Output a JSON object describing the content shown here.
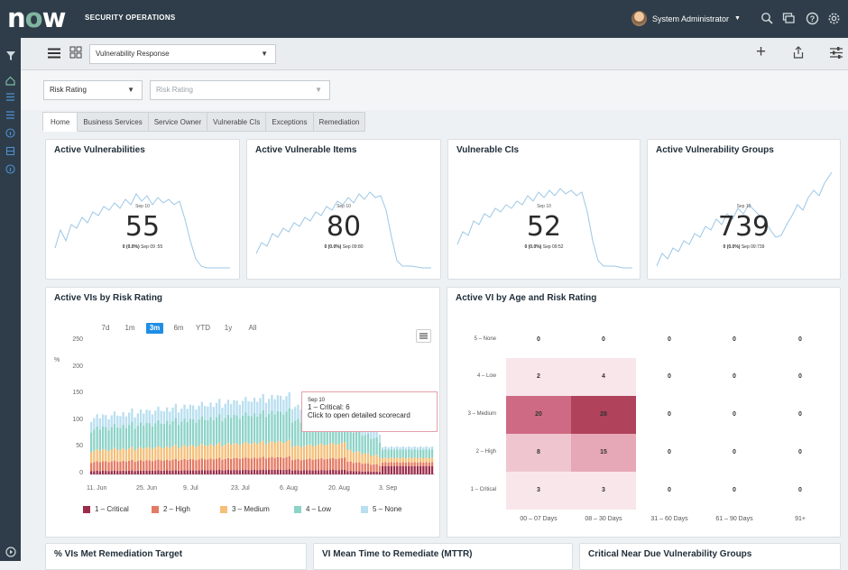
{
  "header": {
    "logo": "now",
    "product": "SECURITY OPERATIONS",
    "user": "System Administrator"
  },
  "toolbar": {
    "workspace": "Vulnerability Response"
  },
  "filters": {
    "filter1": "Risk Rating",
    "filter2_placeholder": "Risk Rating"
  },
  "tabs": [
    "Home",
    "Business Services",
    "Service Owner",
    "Vulnerable CIs",
    "Exceptions",
    "Remediation"
  ],
  "kpis": [
    {
      "title": "Active Vulnerabilities",
      "value": "55",
      "date": "Sep 10",
      "delta": "0 (0.0%)",
      "delta_date": "Sep 09 :55"
    },
    {
      "title": "Active Vulnerable Items",
      "value": "80",
      "date": "Sep 10",
      "delta": "0 (0.0%)",
      "delta_date": "Sep 09:80"
    },
    {
      "title": "Vulnerable CIs",
      "value": "52",
      "date": "Sep 10",
      "delta": "0 (0.0%)",
      "delta_date": "Sep 09:52"
    },
    {
      "title": "Active Vulnerability Groups",
      "value": "739",
      "date": "Sep 10",
      "delta": "0 (0.0%)",
      "delta_date": "Sep 09:739"
    }
  ],
  "bar_card": {
    "title": "Active VIs by Risk Rating",
    "ranges": [
      "7d",
      "1m",
      "3m",
      "6m",
      "YTD",
      "1y",
      "All"
    ],
    "selected_range": "3m",
    "y_unit": "%",
    "tooltip": {
      "date": "Sep 10",
      "line1": "1 – Critical: 6",
      "line2": "Click to open detailed scorecard"
    }
  },
  "heatmap_card": {
    "title": "Active VI by Age and Risk Rating"
  },
  "bottom_cards": [
    "% VIs Met Remediation Target",
    "VI Mean Time to Remediate (MTTR)",
    "Critical Near Due Vulnerability Groups"
  ],
  "chart_data": [
    {
      "type": "bar",
      "title": "Active VIs by Risk Rating",
      "x_tick_labels": [
        "11. Jun",
        "25. Jun",
        "9. Jul",
        "23. Jul",
        "6. Aug",
        "20. Aug",
        "3. Sep"
      ],
      "y_ticks": [
        0,
        50,
        100,
        150,
        200,
        250
      ],
      "ylim": [
        0,
        250
      ],
      "stacked": true,
      "series": [
        {
          "name": "1 – Critical",
          "color": "#9b2d4a"
        },
        {
          "name": "2 – High",
          "color": "#e47a63"
        },
        {
          "name": "3 – Medium",
          "color": "#f4c07a"
        },
        {
          "name": "4 – Low",
          "color": "#8dd3c7"
        },
        {
          "name": "5 – None",
          "color": "#b9dff0"
        }
      ],
      "legend": "bottom"
    },
    {
      "type": "heatmap",
      "title": "Active VI by Age and Risk Rating",
      "y_categories": [
        "5 – None",
        "4 – Low",
        "3 – Medium",
        "2 – High",
        "1 – Critical"
      ],
      "x_categories": [
        "00 – 07 Days",
        "08 – 30 Days",
        "31 – 60 Days",
        "61 – 90 Days",
        "91+"
      ],
      "values": [
        [
          0,
          0,
          0,
          0,
          0
        ],
        [
          2,
          4,
          0,
          0,
          0
        ],
        [
          20,
          28,
          0,
          0,
          0
        ],
        [
          8,
          15,
          0,
          0,
          0
        ],
        [
          3,
          3,
          0,
          0,
          0
        ]
      ]
    }
  ]
}
